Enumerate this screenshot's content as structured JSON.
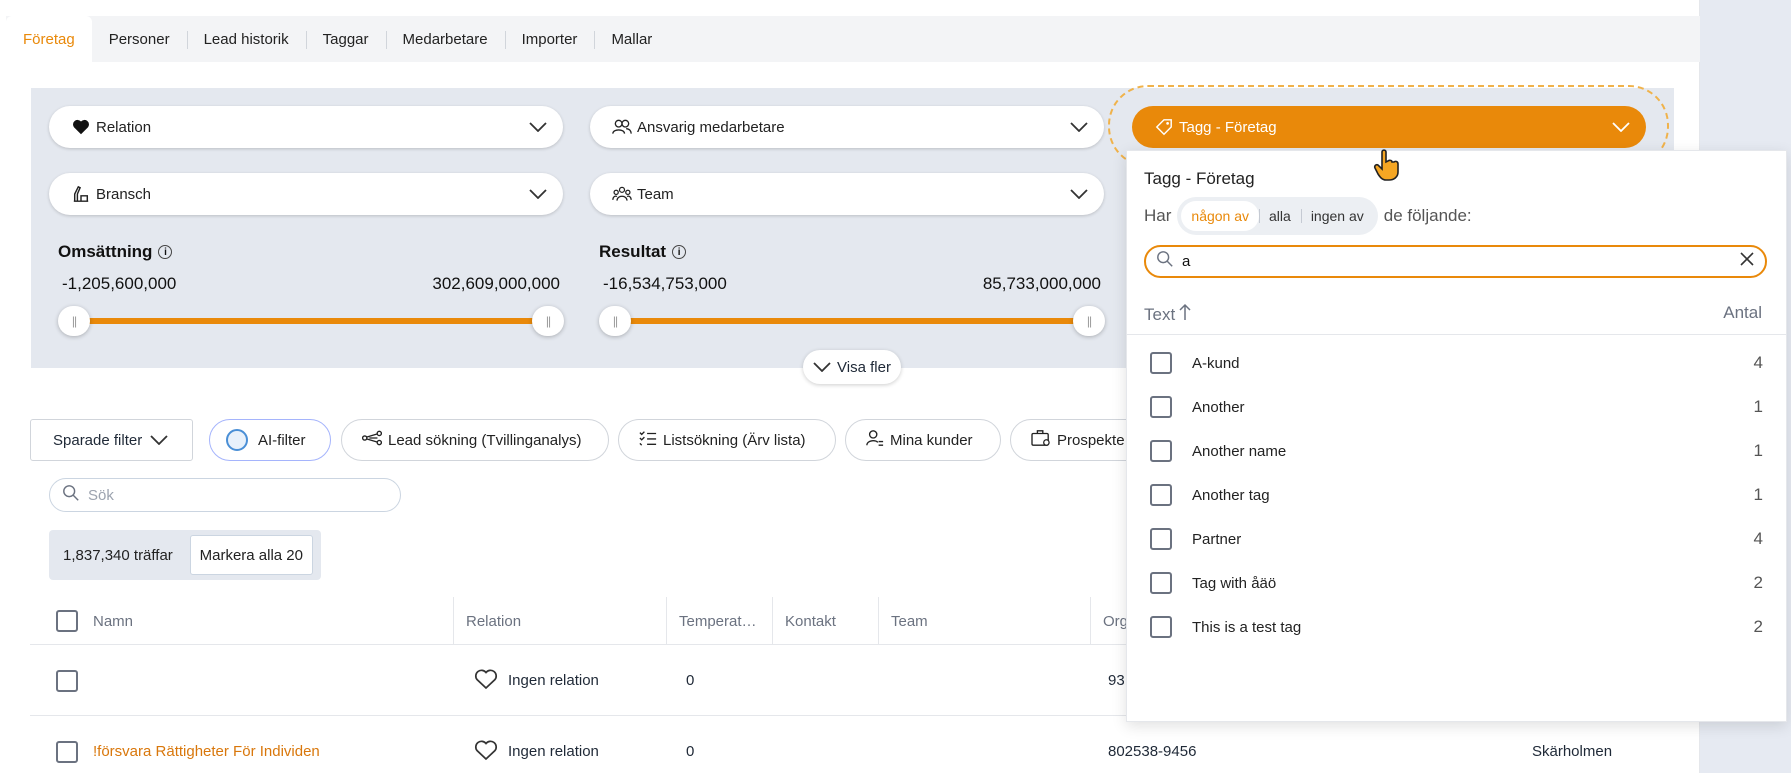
{
  "tabs": [
    "Företag",
    "Personer",
    "Lead historik",
    "Taggar",
    "Medarbetare",
    "Importer",
    "Mallar"
  ],
  "filters": {
    "relation": "Relation",
    "ansvarig": "Ansvarig medarbetare",
    "tagg": "Tagg - Företag",
    "bransch": "Bransch",
    "team": "Team"
  },
  "ranges": {
    "omsattning": {
      "title": "Omsättning",
      "min": "-1,205,600,000",
      "max": "302,609,000,000"
    },
    "resultat": {
      "title": "Resultat",
      "min": "-16,534,753,000",
      "max": "85,733,000,000"
    }
  },
  "visa_fler": "Visa fler",
  "toolbar": {
    "sparade_filter": "Sparade filter",
    "ai_filter": "AI-filter",
    "lead_sokning": "Lead sökning (Tvillinganalys)",
    "listsokning": "Listsökning (Ärv lista)",
    "mina_kunder": "Mina kunder",
    "prospekt": "Prospekte"
  },
  "search": {
    "placeholder": "Sök"
  },
  "hits": {
    "count": "1,837,340 träffar",
    "mark_all": "Markera alla 20"
  },
  "table": {
    "headers": {
      "namn": "Namn",
      "relation": "Relation",
      "temperatur": "Temperat…",
      "kontakt": "Kontakt",
      "team": "Team",
      "org": "Org"
    },
    "rows": [
      {
        "name": "",
        "relation": "Ingen relation",
        "temp": "0",
        "org": "93"
      },
      {
        "name": "!försvara Rättigheter För Individen",
        "relation": "Ingen relation",
        "temp": "0",
        "org": "802538-9456",
        "city": "Skärholmen"
      }
    ]
  },
  "popover": {
    "title": "Tagg - Företag",
    "har": "Har",
    "modes": [
      "någon av",
      "alla",
      "ingen av"
    ],
    "following": "de följande:",
    "search_value": "a",
    "col_text": "Text",
    "col_antal": "Antal",
    "items": [
      {
        "label": "A-kund",
        "count": "4"
      },
      {
        "label": "Another",
        "count": "1"
      },
      {
        "label": "Another name",
        "count": "1"
      },
      {
        "label": "Another tag",
        "count": "1"
      },
      {
        "label": "Partner",
        "count": "4"
      },
      {
        "label": "Tag with åäö",
        "count": "2"
      },
      {
        "label": "This is a test tag",
        "count": "2"
      }
    ]
  },
  "colors": {
    "accent": "#e9890a",
    "panel": "#e4e8ef"
  }
}
